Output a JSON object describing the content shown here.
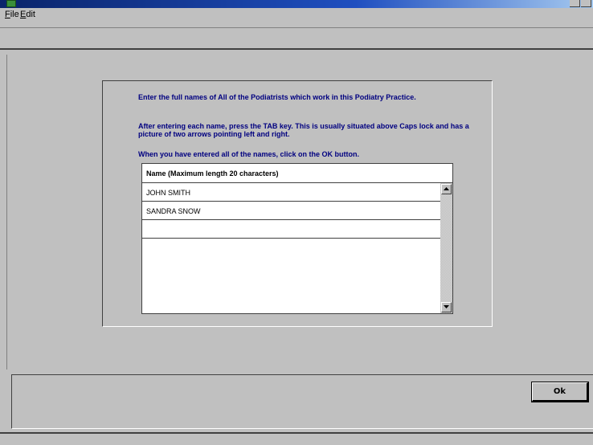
{
  "window": {
    "title": ""
  },
  "menu": {
    "file_label": "File",
    "file_mnemonic": "F",
    "file_rest": "ile",
    "edit_label": "Edit",
    "edit_mnemonic": "E",
    "edit_rest": "dit"
  },
  "instructions": {
    "line1": "Enter the full names of All of the Podiatrists which work in this Podiatry Practice.",
    "line2": "After entering each name, press the TAB key.  This is usually situated above Caps lock and has a picture of two arrows pointing left and right.",
    "line3": "When you have entered all of the names, click on the OK button."
  },
  "grid": {
    "header": "Name  (Maximum length 20 characters)",
    "rows": [
      "JOHN SMITH",
      "SANDRA SNOW",
      ""
    ]
  },
  "buttons": {
    "ok_label": "Ok"
  },
  "icons": {
    "scroll_up": "triangle-up-icon",
    "scroll_down": "triangle-down-icon"
  },
  "colors": {
    "instruction_text": "#000080",
    "window_face": "#c0c0c0",
    "title_bar": "#0a246a"
  }
}
